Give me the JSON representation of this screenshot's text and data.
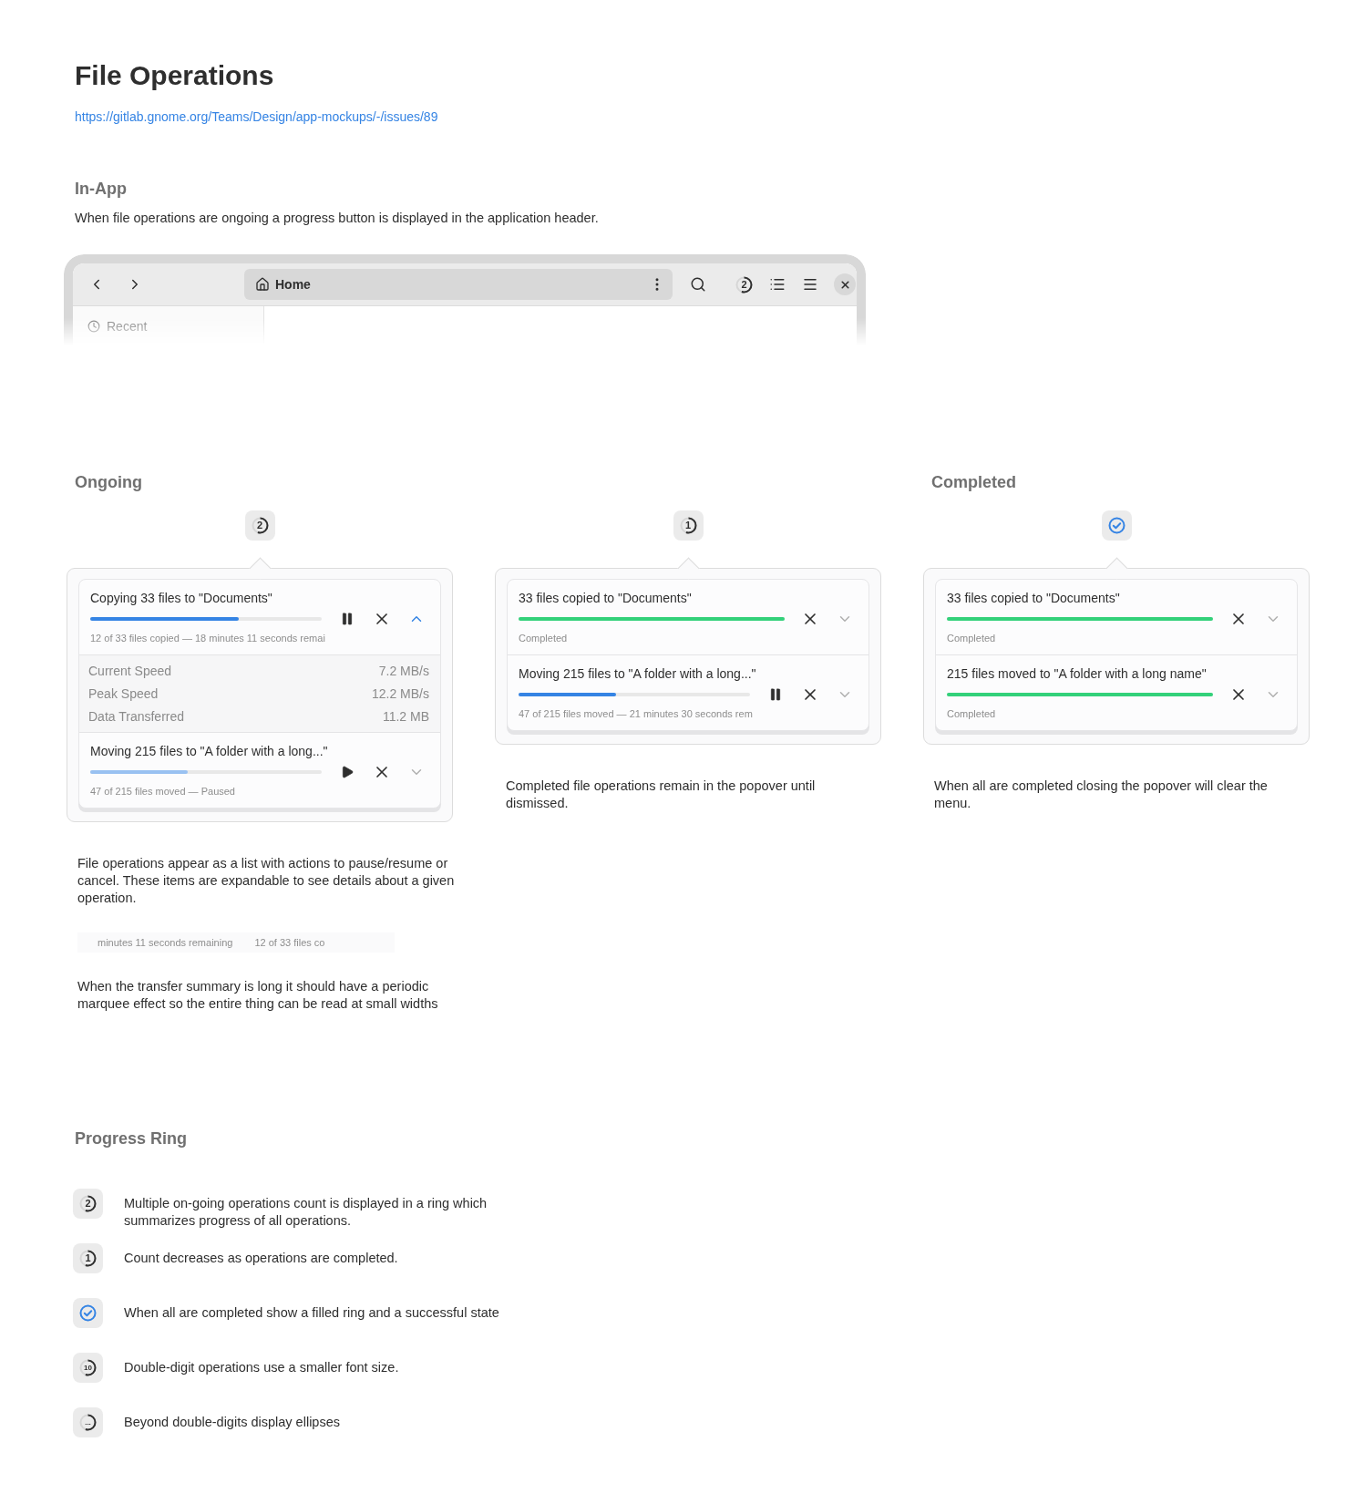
{
  "page": {
    "title": "File Operations",
    "link": "https://gitlab.gnome.org/Teams/Design/app-mockups/-/issues/89"
  },
  "in_app": {
    "heading": "In-App",
    "description": "When file operations are ongoing a progress button is displayed in the application header.",
    "window": {
      "location": "Home",
      "ring": {
        "kind": "count",
        "count": "2"
      },
      "sidebar_items": [
        {
          "label": "Recent"
        }
      ]
    }
  },
  "popovers": [
    {
      "heading": "Ongoing",
      "ring": {
        "kind": "count",
        "count": "2"
      },
      "operations": [
        {
          "title": "Copying 33 files to \"Documents\"",
          "level": 0.64,
          "kind": "running",
          "summary": "12 of 33 files copied — 18 minutes 11 seconds remai",
          "expanded": true,
          "details": [
            {
              "label": "Current Speed",
              "value": "7.2 MB/s"
            },
            {
              "label": "Peak Speed",
              "value": "12.2 MB/s"
            },
            {
              "label": "Data Transferred",
              "value": "11.2 MB"
            }
          ]
        },
        {
          "title": "Moving 215 files to \"A folder with a long...\"",
          "level": 0.42,
          "kind": "paused",
          "summary": "47 of 215 files moved  —  Paused",
          "expanded": false
        }
      ],
      "notes": [
        {
          "kind": "paragraph",
          "text": "File operations appear as a list with actions to pause/resume or cancel. These items are expandable to see details about a given operation."
        },
        {
          "kind": "marquee",
          "texts": [
            "minutes 11 seconds remaining",
            "12 of 33 files co"
          ]
        },
        {
          "kind": "paragraph",
          "text": "When the transfer summary is long it should have a periodic marquee effect so the entire thing can be read at small widths"
        }
      ]
    },
    {
      "ring": {
        "kind": "count",
        "count": "1"
      },
      "operations": [
        {
          "title": "33 files copied to \"Documents\"",
          "level": 1,
          "kind": "done",
          "summary": "Completed",
          "expanded": false
        },
        {
          "title": "Moving 215 files to \"A folder with a long...\"",
          "level": 0.42,
          "kind": "running",
          "summary": "47 of 215 files moved — 21 minutes 30 seconds rem",
          "expanded": false
        }
      ],
      "notes": [
        {
          "kind": "paragraph",
          "text": "Completed file operations remain in the popover until dismissed."
        }
      ]
    },
    {
      "heading": "Completed",
      "ring": {
        "kind": "done"
      },
      "operations": [
        {
          "title": "33 files copied to \"Documents\"",
          "level": 1,
          "kind": "done",
          "summary": "Completed",
          "expanded": false
        },
        {
          "title": "215 files moved to \"A folder with a long name\"",
          "level": 1,
          "kind": "done",
          "summary": "Completed",
          "expanded": false
        }
      ],
      "notes": [
        {
          "kind": "paragraph",
          "text": "When all are completed closing the popover will clear the menu."
        }
      ]
    }
  ],
  "progress_ring": {
    "heading": "Progress Ring",
    "items": [
      {
        "ring": {
          "kind": "count",
          "count": "2"
        },
        "text": "Multiple on-going operations count is displayed in a ring which summarizes progress of all operations."
      },
      {
        "ring": {
          "kind": "count",
          "count": "1"
        },
        "text": "Count decreases as operations are completed."
      },
      {
        "ring": {
          "kind": "done"
        },
        "text": "When all are completed show a filled ring and a successful state"
      },
      {
        "ring": {
          "kind": "count",
          "count": "10"
        },
        "text": "Double-digit operations use a smaller font size."
      },
      {
        "ring": {
          "kind": "count",
          "count": "..."
        },
        "text": "Beyond double-digits display ellipses"
      }
    ]
  }
}
